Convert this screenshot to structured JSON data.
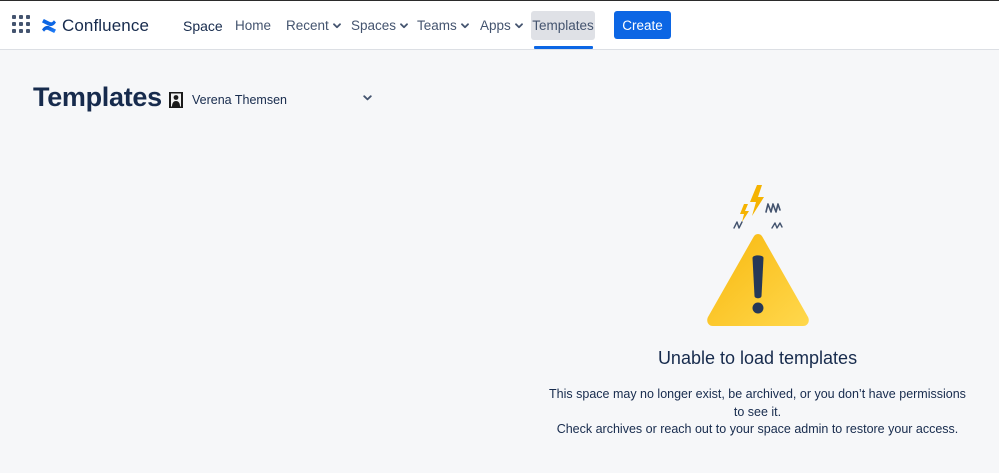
{
  "topnav": {
    "app_name": "Confluence",
    "items": [
      {
        "label": "Space",
        "has_dropdown": false
      },
      {
        "label": "Home",
        "has_dropdown": false
      },
      {
        "label": "Recent",
        "has_dropdown": true
      },
      {
        "label": "Spaces",
        "has_dropdown": true
      },
      {
        "label": "Teams",
        "has_dropdown": true
      },
      {
        "label": "Apps",
        "has_dropdown": true
      },
      {
        "label": "Templates",
        "has_dropdown": false,
        "active": true
      }
    ],
    "create_label": "Create",
    "accent_color": "#0c66e4"
  },
  "header": {
    "title": "Templates",
    "space_selector": {
      "selected": "Verena Themsen"
    }
  },
  "empty_state": {
    "icon": "warning-icon",
    "title": "Unable to load templates",
    "description_line1": "This space may no longer exist, be archived, or you don’t have permissions to see it.",
    "description_line2": "Check archives or reach out to your space admin to restore your access."
  }
}
